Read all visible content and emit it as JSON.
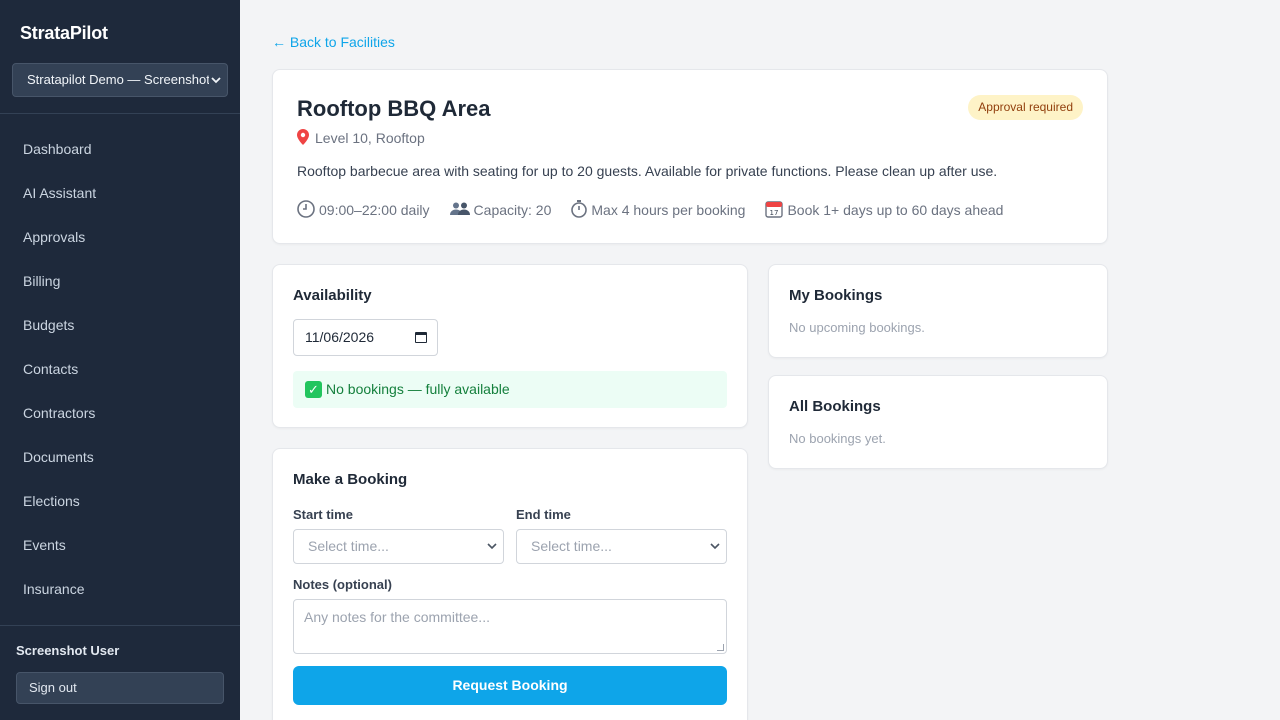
{
  "app": {
    "brand": "StrataPilot",
    "org_selector": "Stratapilot Demo — Screenshot"
  },
  "sidebar": {
    "items": [
      {
        "label": "Dashboard"
      },
      {
        "label": "AI Assistant"
      },
      {
        "label": "Approvals"
      },
      {
        "label": "Billing"
      },
      {
        "label": "Budgets"
      },
      {
        "label": "Contacts"
      },
      {
        "label": "Contractors"
      },
      {
        "label": "Documents"
      },
      {
        "label": "Elections"
      },
      {
        "label": "Events"
      },
      {
        "label": "Insurance"
      }
    ],
    "user_name": "Screenshot User",
    "signout_label": "Sign out"
  },
  "back_link": "← Back to Facilities",
  "facility": {
    "title": "Rooftop BBQ Area",
    "badge": "Approval required",
    "location": "Level 10, Rooftop",
    "description": "Rooftop barbecue area with seating for up to 20 guests. Available for private functions. Please clean up after use.",
    "hours": "09:00–22:00 daily",
    "capacity": "Capacity: 20",
    "max_duration": "Max 4 hours per booking",
    "booking_window": "Book 1+ days up to 60 days ahead"
  },
  "availability": {
    "heading": "Availability",
    "date_value": "11/06/2026",
    "status": "No bookings — fully available"
  },
  "booking_form": {
    "heading": "Make a Booking",
    "start_label": "Start time",
    "start_placeholder": "Select time...",
    "end_label": "End time",
    "end_placeholder": "Select time...",
    "notes_label": "Notes (optional)",
    "notes_placeholder": "Any notes for the committee...",
    "submit_label": "Request Booking"
  },
  "my_bookings": {
    "heading": "My Bookings",
    "empty": "No upcoming bookings."
  },
  "all_bookings": {
    "heading": "All Bookings",
    "empty": "No bookings yet."
  },
  "colors": {
    "sidebar_bg": "#1e293b",
    "accent": "#0ea5e9",
    "badge_bg": "#fef3c7",
    "success_bg": "#ecfdf5"
  }
}
